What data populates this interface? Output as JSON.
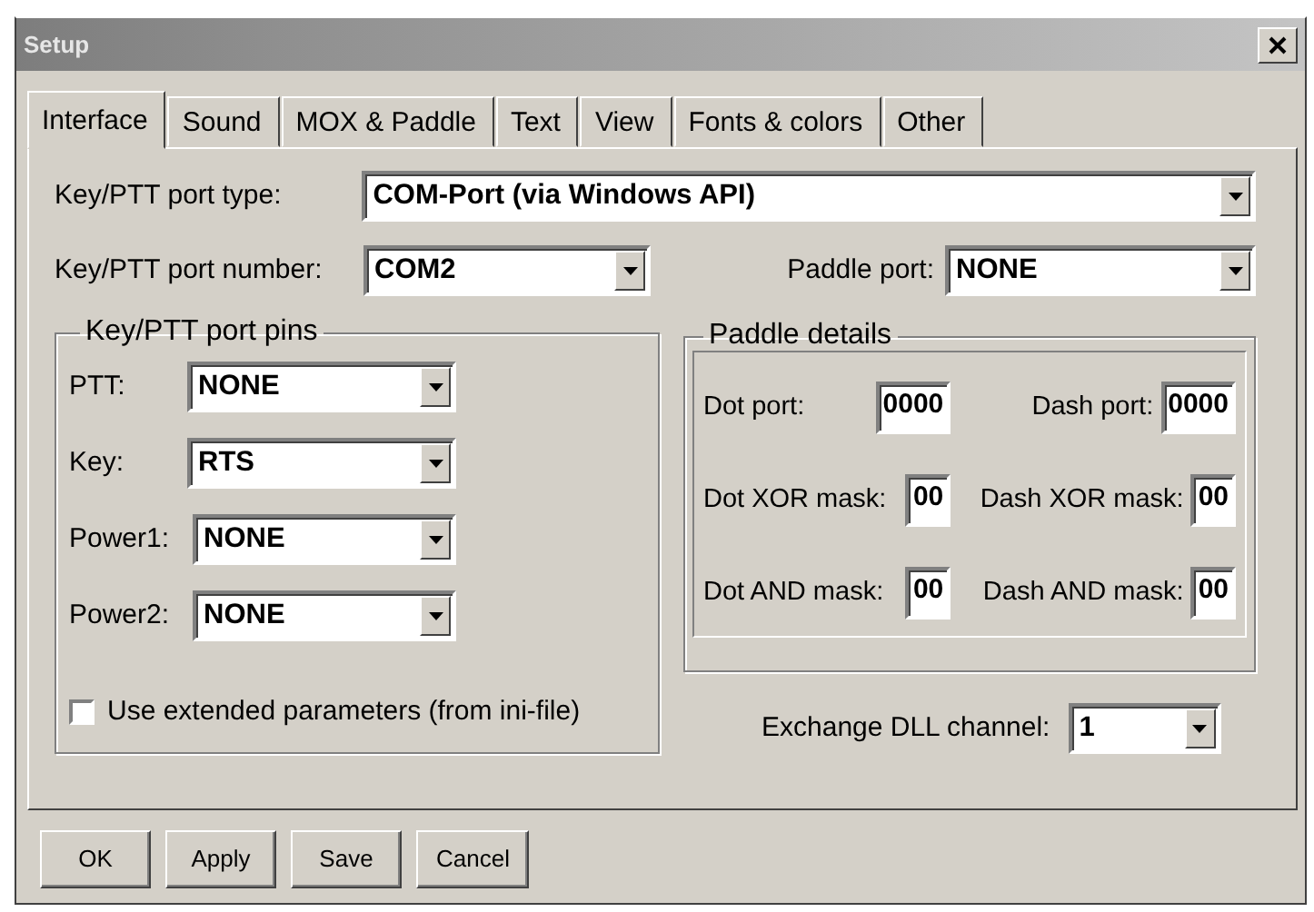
{
  "window": {
    "title": "Setup"
  },
  "tabs": [
    {
      "label": "Interface",
      "selected": true
    },
    {
      "label": "Sound",
      "selected": false
    },
    {
      "label": "MOX & Paddle",
      "selected": false
    },
    {
      "label": "Text",
      "selected": false
    },
    {
      "label": "View",
      "selected": false
    },
    {
      "label": "Fonts & colors",
      "selected": false
    },
    {
      "label": "Other",
      "selected": false
    }
  ],
  "port_type": {
    "label": "Key/PTT port type:",
    "value": "COM-Port (via Windows API)"
  },
  "port_number": {
    "label": "Key/PTT port number:",
    "value": "COM2"
  },
  "paddle_port": {
    "label": "Paddle port:",
    "value": "NONE"
  },
  "port_pins": {
    "title": "Key/PTT port pins",
    "rows": [
      {
        "label": "PTT:",
        "value": "NONE"
      },
      {
        "label": "Key:",
        "value": "RTS"
      },
      {
        "label": "Power1:",
        "value": "NONE"
      },
      {
        "label": "Power2:",
        "value": "NONE"
      }
    ],
    "checkbox": {
      "label": "Use extended parameters (from ini-file)",
      "checked": false
    }
  },
  "paddle_details": {
    "title": "Paddle details",
    "rows": [
      [
        {
          "label": "Dot port:",
          "value": "0000"
        },
        {
          "label": "Dash port:",
          "value": "0000"
        }
      ],
      [
        {
          "label": "Dot XOR mask:",
          "value": "00"
        },
        {
          "label": "Dash XOR mask:",
          "value": "00"
        }
      ],
      [
        {
          "label": "Dot AND mask:",
          "value": "00"
        },
        {
          "label": "Dash AND mask:",
          "value": "00"
        }
      ]
    ]
  },
  "exchange_dll": {
    "label": "Exchange DLL channel:",
    "value": "1"
  },
  "buttons": [
    "OK",
    "Apply",
    "Save",
    "Cancel"
  ]
}
